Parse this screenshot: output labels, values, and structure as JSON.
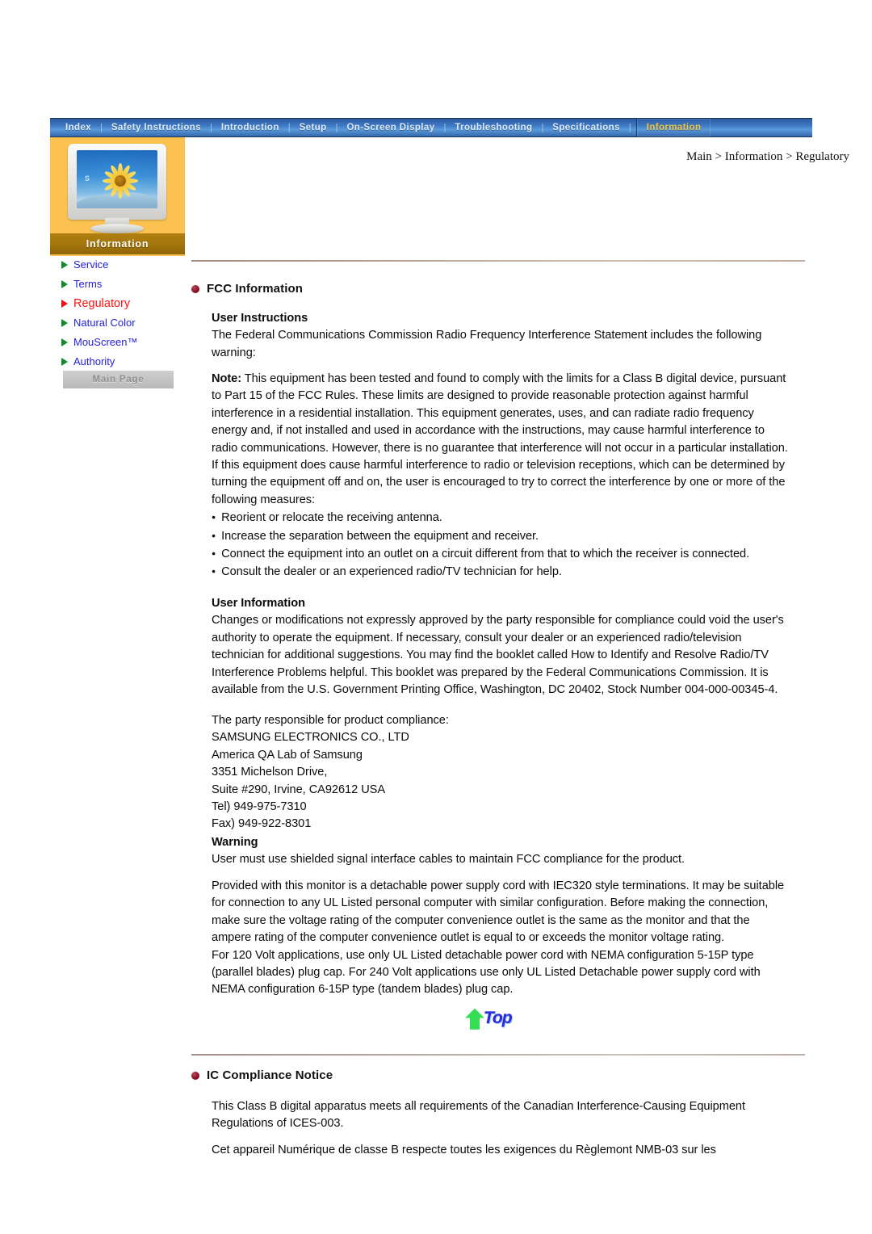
{
  "nav": {
    "items": [
      {
        "label": "Index",
        "active": false
      },
      {
        "label": "Safety Instructions",
        "active": false
      },
      {
        "label": "Introduction",
        "active": false
      },
      {
        "label": "Setup",
        "active": false
      },
      {
        "label": "On-Screen Display",
        "active": false
      },
      {
        "label": "Troubleshooting",
        "active": false
      },
      {
        "label": "Specifications",
        "active": false
      },
      {
        "label": "Information",
        "active": true
      }
    ],
    "separator": "|"
  },
  "sidebar": {
    "section_label": "Information",
    "monitor_screen_logo": "S",
    "items": [
      {
        "label": "Service",
        "current": false
      },
      {
        "label": "Terms",
        "current": false
      },
      {
        "label": "Regulatory",
        "current": true
      },
      {
        "label": "Natural Color",
        "current": false
      },
      {
        "label": "MouScreen™",
        "current": false
      },
      {
        "label": "Authority",
        "current": false
      }
    ],
    "main_page_button": "Main Page"
  },
  "breadcrumb": "Main > Information > Regulatory",
  "content": {
    "fcc": {
      "heading": "FCC Information",
      "user_instructions_head": "User Instructions",
      "user_instructions_body": "The Federal Communications Commission Radio Frequency Interference Statement includes the following warning:",
      "note_label": "Note:",
      "note_body": " This equipment has been tested and found to comply with the limits for a Class B digital device, pursuant to Part 15 of the FCC Rules. These limits are designed to provide reasonable protection against harmful interference in a residential installation. This equipment generates, uses, and can radiate radio frequency energy and, if not installed and used in accordance with the instructions, may cause harmful interference to radio communications. However, there is no guarantee that interference will not occur in a particular installation. If this equipment does cause harmful interference to radio or television receptions, which can be determined by turning the equipment off and on, the user is encouraged to try to correct the interference by one or more of the following measures:",
      "measures": [
        "Reorient or relocate the receiving antenna.",
        "Increase the separation between the equipment and receiver.",
        "Connect the equipment into an outlet on a circuit different from that to which the receiver is connected.",
        "Consult the dealer or an experienced radio/TV technician for help."
      ],
      "user_information_head": "User Information",
      "user_information_body": "Changes or modifications not expressly approved by the party responsible for compliance could void the user's authority to operate the equipment. If necessary, consult your dealer or an experienced radio/television technician for additional suggestions. You may find the booklet called How to Identify and Resolve Radio/TV Interference Problems helpful. This booklet was prepared by the Federal Communications Commission. It is available from the U.S. Government Printing Office, Washington, DC 20402, Stock Number 004-000-00345-4.",
      "compliance_lines": [
        "The party responsible for product compliance:",
        "SAMSUNG ELECTRONICS CO., LTD",
        "America QA Lab of Samsung",
        "3351 Michelson Drive,",
        "Suite #290, Irvine, CA92612 USA",
        "Tel) 949-975-7310",
        "Fax) 949-922-8301"
      ],
      "warning_head": "Warning",
      "warning_body": "User must use shielded signal interface cables to maintain FCC compliance for the product.",
      "power_cord_body": "Provided with this monitor is a detachable power supply cord with IEC320 style terminations. It may be suitable for connection to any UL Listed personal computer with similar configuration. Before making the connection, make sure the voltage rating of the computer convenience outlet is the same as the monitor and that the ampere rating of the computer convenience outlet is equal to or exceeds the monitor voltage rating.",
      "nema_body": "For 120 Volt applications, use only UL Listed detachable power cord with NEMA configuration 5-15P type (parallel blades) plug cap. For 240 Volt applications use only UL Listed Detachable power supply cord with NEMA configuration 6-15P type (tandem blades) plug cap."
    },
    "top_button_label": "Top",
    "ic": {
      "heading": "IC Compliance Notice",
      "english": "This Class B digital apparatus meets all requirements of the Canadian Interference-Causing Equipment Regulations of ICES-003.",
      "french": "Cet appareil Numérique de classe B respecte toutes les exigences du Règlemont NMB-03 sur les"
    }
  },
  "colors": {
    "nav_blue": "#3d78c4",
    "nav_active_text": "#f7c43c",
    "sidebar_orange": "#fcc251",
    "section_band": "#a5760d",
    "link_blue": "#2222dd",
    "current_red": "#ff1111",
    "triangle_green": "#0f8a2e",
    "bullet_maroon": "#8e1028"
  }
}
